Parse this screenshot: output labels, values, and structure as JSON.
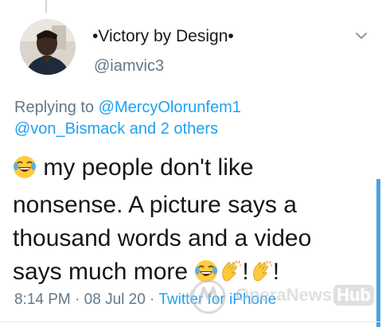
{
  "tweet": {
    "display_name": "•Victory by Design•",
    "handle": "@iamvic3",
    "replying_prefix": "Replying to ",
    "replying_to_1": "@MercyOlorunfem1",
    "replying_to_2": "@von_Bismack",
    "replying_suffix": " and 2 others",
    "text_line_1": " my people don't like",
    "text_line_2": "nonsense. A picture says a",
    "text_line_3": "thousand words and a video",
    "text_line_4": "says much more ",
    "text_line_4_tail_1": "!",
    "text_line_4_tail_2": "!",
    "time": "8:14 PM",
    "separator": " · ",
    "date": "08 Jul 20",
    "source": "Twitter for iPhone",
    "emojis": [
      "face-with-tears-of-joy",
      "face-with-tears-of-joy",
      "clapping-hands",
      "clapping-hands"
    ]
  },
  "watermark": {
    "text": "OperaNews",
    "hub": "Hub"
  },
  "colors": {
    "link": "#1da1f2",
    "secondary_text": "#657786",
    "primary_text": "#14171a",
    "scroll_accent": "#4aa3df"
  }
}
